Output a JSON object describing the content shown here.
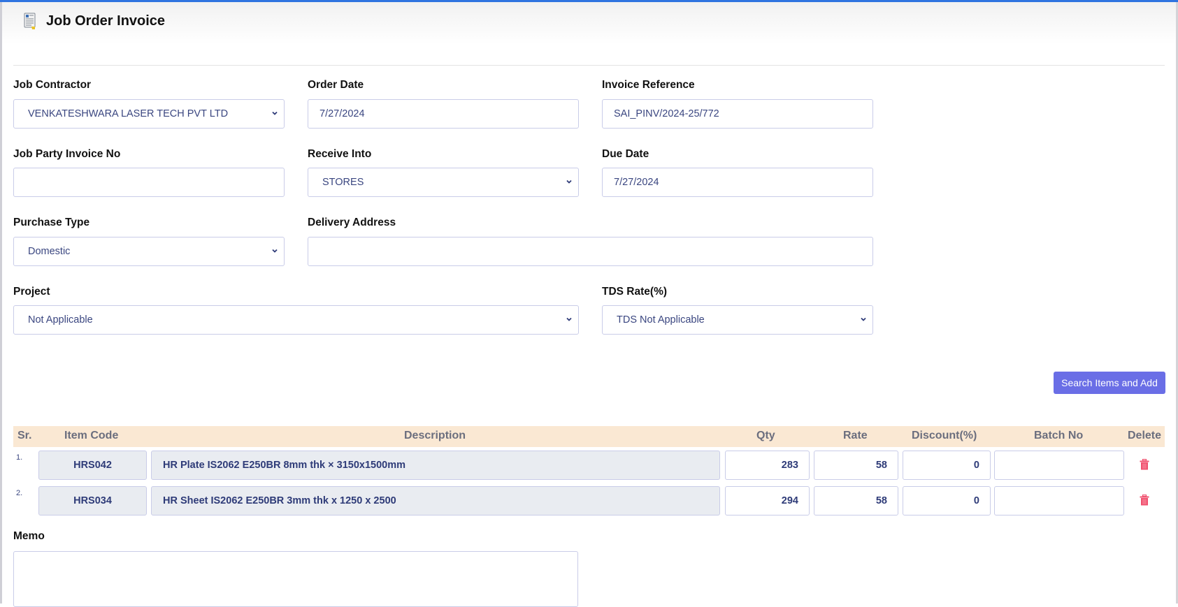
{
  "header": {
    "title": "Job Order Invoice",
    "icon": "invoice-document-icon"
  },
  "form": {
    "job_contractor": {
      "label": "Job Contractor",
      "value": "VENKATESHWARA LASER TECH PVT LTD"
    },
    "order_date": {
      "label": "Order Date",
      "value": "7/27/2024"
    },
    "invoice_reference": {
      "label": "Invoice Reference",
      "value": "SAI_PINV/2024-25/772"
    },
    "job_party_invoice_no": {
      "label": "Job Party Invoice No",
      "value": ""
    },
    "receive_into": {
      "label": "Receive Into",
      "value": "STORES"
    },
    "due_date": {
      "label": "Due Date",
      "value": "7/27/2024"
    },
    "purchase_type": {
      "label": "Purchase Type",
      "value": "Domestic"
    },
    "delivery_address": {
      "label": "Delivery Address",
      "value": ""
    },
    "project": {
      "label": "Project",
      "value": "Not Applicable"
    },
    "tds_rate": {
      "label": "TDS Rate(%)",
      "value": "TDS Not Applicable"
    }
  },
  "actions": {
    "search_items_label": "Search Items and Add"
  },
  "items_table": {
    "columns": [
      "Sr.",
      "Item Code",
      "Description",
      "Qty",
      "Rate",
      "Discount(%)",
      "Batch No",
      "Delete"
    ],
    "rows": [
      {
        "sr": "1.",
        "item_code": "HRS042",
        "description": "HR Plate IS2062 E250BR 8mm thk × 3150x1500mm",
        "qty": "283",
        "rate": "58",
        "discount": "0",
        "batch_no": ""
      },
      {
        "sr": "2.",
        "item_code": "HRS034",
        "description": "HR Sheet IS2062 E250BR 3mm thk x 1250 x 2500",
        "qty": "294",
        "rate": "58",
        "discount": "0",
        "batch_no": ""
      }
    ]
  },
  "memo": {
    "label": "Memo",
    "value": ""
  },
  "colors": {
    "accent": "#2f74e0",
    "button": "#6a6ee6",
    "table_header_bg": "#fae8d3",
    "delete_icon": "#f0506e",
    "field_text": "#3a4680"
  }
}
